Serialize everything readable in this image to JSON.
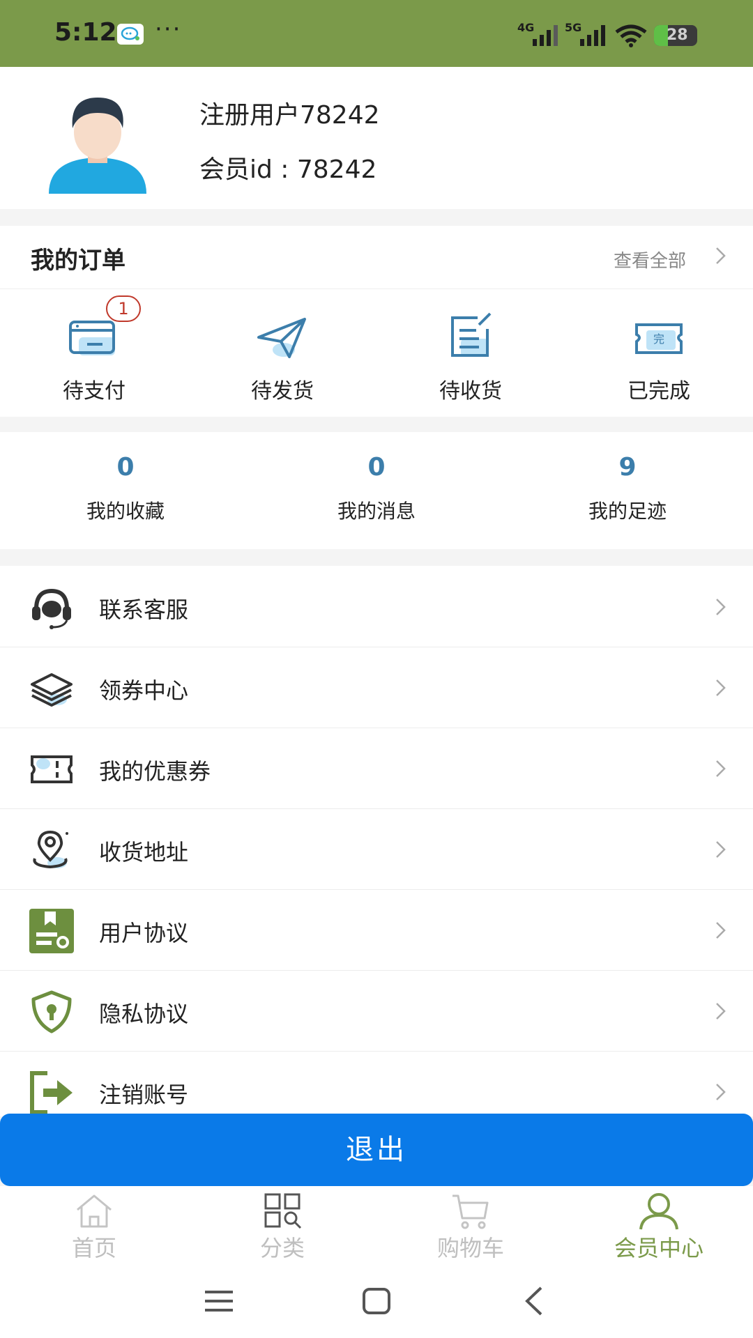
{
  "status_bar": {
    "time": "5:12",
    "more": "···",
    "signal_1": "4G",
    "signal_2": "5G",
    "battery": "28"
  },
  "profile": {
    "name": "注册用户78242",
    "member_id": "会员id : 78242"
  },
  "orders": {
    "title": "我的订单",
    "view_all": "查看全部",
    "items": [
      {
        "label": "待支付",
        "badge": "1",
        "icon": "wallet-card-icon"
      },
      {
        "label": "待发货",
        "icon": "paper-plane-icon"
      },
      {
        "label": "待收货",
        "icon": "document-icon"
      },
      {
        "label": "已完成",
        "icon": "completed-ticket-icon"
      }
    ]
  },
  "stats": [
    {
      "value": "0",
      "label": "我的收藏"
    },
    {
      "value": "0",
      "label": "我的消息"
    },
    {
      "value": "9",
      "label": "我的足迹"
    }
  ],
  "menu": [
    {
      "label": "联系客服",
      "icon": "headset-icon"
    },
    {
      "label": "领券中心",
      "icon": "layers-icon"
    },
    {
      "label": "我的优惠券",
      "icon": "coupon-icon"
    },
    {
      "label": "收货地址",
      "icon": "location-pin-icon"
    },
    {
      "label": "用户协议",
      "icon": "agreement-icon"
    },
    {
      "label": "隐私协议",
      "icon": "shield-lock-icon"
    },
    {
      "label": "注销账号",
      "icon": "exit-icon"
    }
  ],
  "logout_label": "退出",
  "tabs": [
    {
      "label": "首页",
      "icon": "home-icon"
    },
    {
      "label": "分类",
      "icon": "category-icon"
    },
    {
      "label": "购物车",
      "icon": "cart-icon"
    },
    {
      "label": "会员中心",
      "icon": "user-icon",
      "active": true
    }
  ],
  "colors": {
    "brand_green": "#7b9a4a",
    "accent_blue": "#3c7eab",
    "logout_blue": "#0a7ae8",
    "badge_red": "#c0392b"
  }
}
